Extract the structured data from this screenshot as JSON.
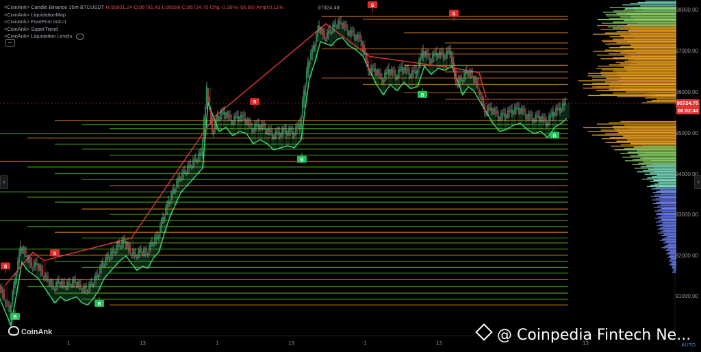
{
  "legend": {
    "line1_prefix": "<CoinAnk>",
    "line1_type": "Candle",
    "line1_exchange": "Binance 15m BTCUSDT",
    "line1_values": "H:95801.24  O:95781.43  L:95696  C:95724.75  Chg:-0.06%(-56.68)  Ampl:0.11%",
    "line2": "<CoinAnk>  LiquidationMap",
    "line3": "<CoinAnk>  FootPrint   tick=1",
    "line4": "<CoinAnk>  SuperTrend",
    "line5": "<CoinAnk>  Liquidation Levels"
  },
  "price_axis": {
    "ticks": [
      "98000.00",
      "97000.00",
      "96000.00",
      "95000.00",
      "94000.00",
      "93000.00",
      "92000.00",
      "91000.00"
    ],
    "current_price": "95724.75",
    "countdown": "00:02:44",
    "auto_label": "AUTO"
  },
  "time_axis": {
    "labels": [
      "1",
      "13",
      "1",
      "13",
      "1",
      "13",
      "13"
    ]
  },
  "annotations": {
    "high_label": "97924.49",
    "sell_label": "S",
    "buy_label": "B"
  },
  "nav": {
    "left": "‹",
    "right": "›"
  },
  "brand": "CoinAnk",
  "watermark": "@ Coinpedia Fintech Ne...",
  "colors": {
    "bull": "#26a65b",
    "bear": "#e0383a",
    "supertrend_up": "#3de07a",
    "supertrend_down": "#e0383a",
    "liq_band": "#f0a020"
  },
  "chart_data": {
    "type": "candlestick",
    "instrument": "BTCUSDT",
    "exchange": "Binance",
    "interval": "15m",
    "ylim": [
      90600,
      98300
    ],
    "last_ohlc": {
      "open": 95781.43,
      "high": 95801.24,
      "low": 95696,
      "close": 95724.75
    },
    "close_path": [
      [
        0,
        91300
      ],
      [
        8,
        90900
      ],
      [
        16,
        90650
      ],
      [
        24,
        91400
      ],
      [
        32,
        92200
      ],
      [
        40,
        92000
      ],
      [
        48,
        91700
      ],
      [
        56,
        91800
      ],
      [
        64,
        91500
      ],
      [
        72,
        91400
      ],
      [
        80,
        91200
      ],
      [
        88,
        91350
      ],
      [
        96,
        91250
      ],
      [
        104,
        91300
      ],
      [
        112,
        91350
      ],
      [
        120,
        91200
      ],
      [
        128,
        91150
      ],
      [
        136,
        91300
      ],
      [
        144,
        91500
      ],
      [
        152,
        91800
      ],
      [
        160,
        91950
      ],
      [
        168,
        92100
      ],
      [
        176,
        92250
      ],
      [
        184,
        92350
      ],
      [
        192,
        92050
      ],
      [
        200,
        92000
      ],
      [
        208,
        92100
      ],
      [
        216,
        92050
      ],
      [
        224,
        92300
      ],
      [
        232,
        92450
      ],
      [
        240,
        92900
      ],
      [
        248,
        93300
      ],
      [
        256,
        93600
      ],
      [
        264,
        93900
      ],
      [
        272,
        94050
      ],
      [
        280,
        94200
      ],
      [
        288,
        94350
      ],
      [
        296,
        94500
      ],
      [
        300,
        95300
      ],
      [
        304,
        96100
      ],
      [
        312,
        95000
      ],
      [
        320,
        95400
      ],
      [
        330,
        95500
      ],
      [
        340,
        95300
      ],
      [
        350,
        95400
      ],
      [
        360,
        95350
      ],
      [
        370,
        95100
      ],
      [
        380,
        95200
      ],
      [
        390,
        95100
      ],
      [
        400,
        94950
      ],
      [
        410,
        95000
      ],
      [
        420,
        95050
      ],
      [
        430,
        95000
      ],
      [
        440,
        95200
      ],
      [
        446,
        96000
      ],
      [
        452,
        96700
      ],
      [
        460,
        97100
      ],
      [
        468,
        97600
      ],
      [
        476,
        97300
      ],
      [
        484,
        97500
      ],
      [
        492,
        97650
      ],
      [
        500,
        97700
      ],
      [
        510,
        97500
      ],
      [
        520,
        97400
      ],
      [
        530,
        97250
      ],
      [
        540,
        96500
      ],
      [
        550,
        96550
      ],
      [
        560,
        96300
      ],
      [
        570,
        96550
      ],
      [
        580,
        96400
      ],
      [
        590,
        96600
      ],
      [
        600,
        96450
      ],
      [
        610,
        96500
      ],
      [
        620,
        97000
      ],
      [
        630,
        96800
      ],
      [
        640,
        96950
      ],
      [
        650,
        96900
      ],
      [
        660,
        97000
      ],
      [
        668,
        96200
      ],
      [
        676,
        96300
      ],
      [
        684,
        96500
      ],
      [
        692,
        96400
      ],
      [
        700,
        96100
      ],
      [
        710,
        95500
      ],
      [
        720,
        95600
      ],
      [
        730,
        95400
      ],
      [
        740,
        95450
      ],
      [
        750,
        95550
      ],
      [
        760,
        95600
      ],
      [
        770,
        95450
      ],
      [
        780,
        95350
      ],
      [
        790,
        95400
      ],
      [
        800,
        95250
      ],
      [
        810,
        95500
      ],
      [
        820,
        95600
      ],
      [
        828,
        95720
      ]
    ],
    "signals": [
      {
        "type": "S",
        "x": 8,
        "price": 91550
      },
      {
        "type": "S",
        "x": 80,
        "price": 91870
      },
      {
        "type": "B",
        "x": 145,
        "price": 90970
      },
      {
        "type": "S",
        "x": 372,
        "price": 95580
      },
      {
        "type": "B",
        "x": 441,
        "price": 94500
      },
      {
        "type": "S",
        "x": 544,
        "price": 97950
      },
      {
        "type": "B",
        "x": 617,
        "price": 96090
      },
      {
        "type": "S",
        "x": 663,
        "price": 97740
      },
      {
        "type": "B",
        "x": 810,
        "price": 95090
      },
      {
        "type": "B",
        "x": 22,
        "price": 90650
      }
    ],
    "liquidation_levels": [
      {
        "price": 97850,
        "side": "short"
      },
      {
        "price": 97780,
        "side": "short"
      },
      {
        "price": 97450,
        "side": "short"
      },
      {
        "price": 97200,
        "side": "short"
      },
      {
        "price": 97060,
        "side": "short"
      },
      {
        "price": 96930,
        "side": "short"
      },
      {
        "price": 96650,
        "side": "short"
      },
      {
        "price": 96490,
        "side": "short"
      },
      {
        "price": 96340,
        "side": "short"
      },
      {
        "price": 96180,
        "side": "short"
      },
      {
        "price": 95980,
        "side": "short"
      },
      {
        "price": 95820,
        "side": "short"
      },
      {
        "price": 95300,
        "side": "long"
      },
      {
        "price": 95200,
        "side": "long"
      },
      {
        "price": 95100,
        "side": "long"
      },
      {
        "price": 94980,
        "side": "long"
      },
      {
        "price": 94870,
        "side": "long"
      },
      {
        "price": 94720,
        "side": "long"
      },
      {
        "price": 94600,
        "side": "long"
      },
      {
        "price": 94450,
        "side": "long"
      },
      {
        "price": 94300,
        "side": "long"
      },
      {
        "price": 94160,
        "side": "long"
      },
      {
        "price": 94000,
        "side": "long"
      },
      {
        "price": 93850,
        "side": "long"
      },
      {
        "price": 93700,
        "side": "long"
      },
      {
        "price": 93550,
        "side": "long"
      },
      {
        "price": 93420,
        "side": "long"
      },
      {
        "price": 93300,
        "side": "long"
      },
      {
        "price": 93130,
        "side": "long"
      },
      {
        "price": 93000,
        "side": "long"
      },
      {
        "price": 92850,
        "side": "long"
      },
      {
        "price": 92700,
        "side": "long"
      },
      {
        "price": 92560,
        "side": "long"
      },
      {
        "price": 92420,
        "side": "long"
      },
      {
        "price": 92300,
        "side": "long"
      },
      {
        "price": 92150,
        "side": "long"
      },
      {
        "price": 92000,
        "side": "long"
      },
      {
        "price": 91850,
        "side": "long"
      },
      {
        "price": 91700,
        "side": "long"
      },
      {
        "price": 91560,
        "side": "long"
      },
      {
        "price": 91400,
        "side": "long"
      },
      {
        "price": 91230,
        "side": "long"
      },
      {
        "price": 91070,
        "side": "long"
      },
      {
        "price": 90920,
        "side": "long"
      },
      {
        "price": 90780,
        "side": "long"
      }
    ],
    "volume_profile": [
      {
        "price": 98100,
        "weight": 0.55,
        "tone": "cyan"
      },
      {
        "price": 97950,
        "weight": 0.75,
        "tone": "green"
      },
      {
        "price": 97800,
        "weight": 0.8,
        "tone": "green"
      },
      {
        "price": 97650,
        "weight": 0.7,
        "tone": "green"
      },
      {
        "price": 97500,
        "weight": 0.85,
        "tone": "orange"
      },
      {
        "price": 97350,
        "weight": 0.75,
        "tone": "orange"
      },
      {
        "price": 97200,
        "weight": 0.8,
        "tone": "orange"
      },
      {
        "price": 97050,
        "weight": 0.7,
        "tone": "orange"
      },
      {
        "price": 96900,
        "weight": 0.85,
        "tone": "orange"
      },
      {
        "price": 96750,
        "weight": 0.65,
        "tone": "orange"
      },
      {
        "price": 96600,
        "weight": 0.8,
        "tone": "orange"
      },
      {
        "price": 96450,
        "weight": 0.9,
        "tone": "orange"
      },
      {
        "price": 96300,
        "weight": 1.0,
        "tone": "orange"
      },
      {
        "price": 96150,
        "weight": 0.95,
        "tone": "orange"
      },
      {
        "price": 96000,
        "weight": 0.9,
        "tone": "orange"
      },
      {
        "price": 95850,
        "weight": 0.35,
        "tone": "orange"
      },
      {
        "price": 95150,
        "weight": 0.85,
        "tone": "orange"
      },
      {
        "price": 95000,
        "weight": 0.95,
        "tone": "orange"
      },
      {
        "price": 94850,
        "weight": 0.8,
        "tone": "orange"
      },
      {
        "price": 94700,
        "weight": 0.7,
        "tone": "orange"
      },
      {
        "price": 94550,
        "weight": 0.6,
        "tone": "green"
      },
      {
        "price": 94400,
        "weight": 0.55,
        "tone": "green"
      },
      {
        "price": 94250,
        "weight": 0.45,
        "tone": "green"
      },
      {
        "price": 94100,
        "weight": 0.4,
        "tone": "cyan"
      },
      {
        "price": 93950,
        "weight": 0.35,
        "tone": "cyan"
      },
      {
        "price": 93800,
        "weight": 0.3,
        "tone": "cyan"
      },
      {
        "price": 93650,
        "weight": 0.28,
        "tone": "cyan"
      },
      {
        "price": 93500,
        "weight": 0.25,
        "tone": "blue"
      },
      {
        "price": 93350,
        "weight": 0.26,
        "tone": "blue"
      },
      {
        "price": 93200,
        "weight": 0.24,
        "tone": "blue"
      },
      {
        "price": 93050,
        "weight": 0.22,
        "tone": "blue"
      },
      {
        "price": 92900,
        "weight": 0.22,
        "tone": "blue"
      },
      {
        "price": 92750,
        "weight": 0.2,
        "tone": "blue"
      },
      {
        "price": 92600,
        "weight": 0.19,
        "tone": "blue"
      },
      {
        "price": 92450,
        "weight": 0.17,
        "tone": "blue"
      },
      {
        "price": 92300,
        "weight": 0.15,
        "tone": "blue"
      },
      {
        "price": 92150,
        "weight": 0.12,
        "tone": "blue"
      },
      {
        "price": 92000,
        "weight": 0.1,
        "tone": "blue"
      },
      {
        "price": 91850,
        "weight": 0.08,
        "tone": "blue"
      },
      {
        "price": 91700,
        "weight": 0.05,
        "tone": "blue"
      }
    ]
  }
}
